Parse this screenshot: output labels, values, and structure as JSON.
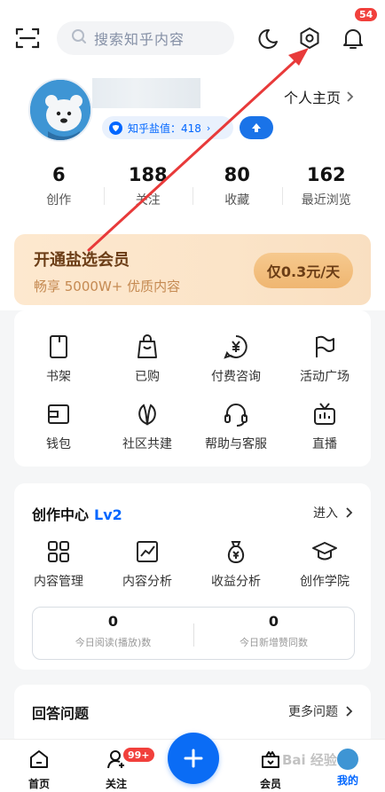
{
  "header": {
    "search_placeholder": "搜索知乎内容",
    "notification_count": "54"
  },
  "profile": {
    "salt_label": "知乎盐值：418",
    "homepage_label": "个人主页"
  },
  "stats": [
    {
      "value": "6",
      "label": "创作"
    },
    {
      "value": "188",
      "label": "关注"
    },
    {
      "value": "80",
      "label": "收藏"
    },
    {
      "value": "162",
      "label": "最近浏览"
    }
  ],
  "vip": {
    "title": "开通盐选会员",
    "subtitle": "畅享 5000W+ 优质内容",
    "button": "仅0.3元/天"
  },
  "features": [
    {
      "label": "书架",
      "icon": "bookshelf-icon"
    },
    {
      "label": "已购",
      "icon": "purchased-bag-icon"
    },
    {
      "label": "付费咨询",
      "icon": "paid-consult-icon"
    },
    {
      "label": "活动广场",
      "icon": "flag-icon"
    },
    {
      "label": "钱包",
      "icon": "wallet-icon"
    },
    {
      "label": "社区共建",
      "icon": "community-leaf-icon"
    },
    {
      "label": "帮助与客服",
      "icon": "headset-icon"
    },
    {
      "label": "直播",
      "icon": "live-tv-icon"
    }
  ],
  "creation": {
    "title": "创作中心",
    "level": "Lv2",
    "enter": "进入",
    "tools": [
      {
        "label": "内容管理",
        "icon": "content-grid-icon"
      },
      {
        "label": "内容分析",
        "icon": "chart-line-icon"
      },
      {
        "label": "收益分析",
        "icon": "money-bag-icon"
      },
      {
        "label": "创作学院",
        "icon": "graduation-cap-icon"
      }
    ],
    "today": [
      {
        "value": "0",
        "label": "今日阅读(播放)数"
      },
      {
        "value": "0",
        "label": "今日新增赞同数"
      }
    ]
  },
  "answer": {
    "title": "回答问题",
    "more": "更多问题"
  },
  "tabbar": {
    "home": "首页",
    "follow": "关注",
    "follow_badge": "99+",
    "vip": "会员",
    "me": "我的"
  },
  "watermark": "Bai 经验",
  "colors": {
    "accent": "#0066ff",
    "annotation_arrow": "#e83a3a",
    "badge": "#f1403c"
  }
}
